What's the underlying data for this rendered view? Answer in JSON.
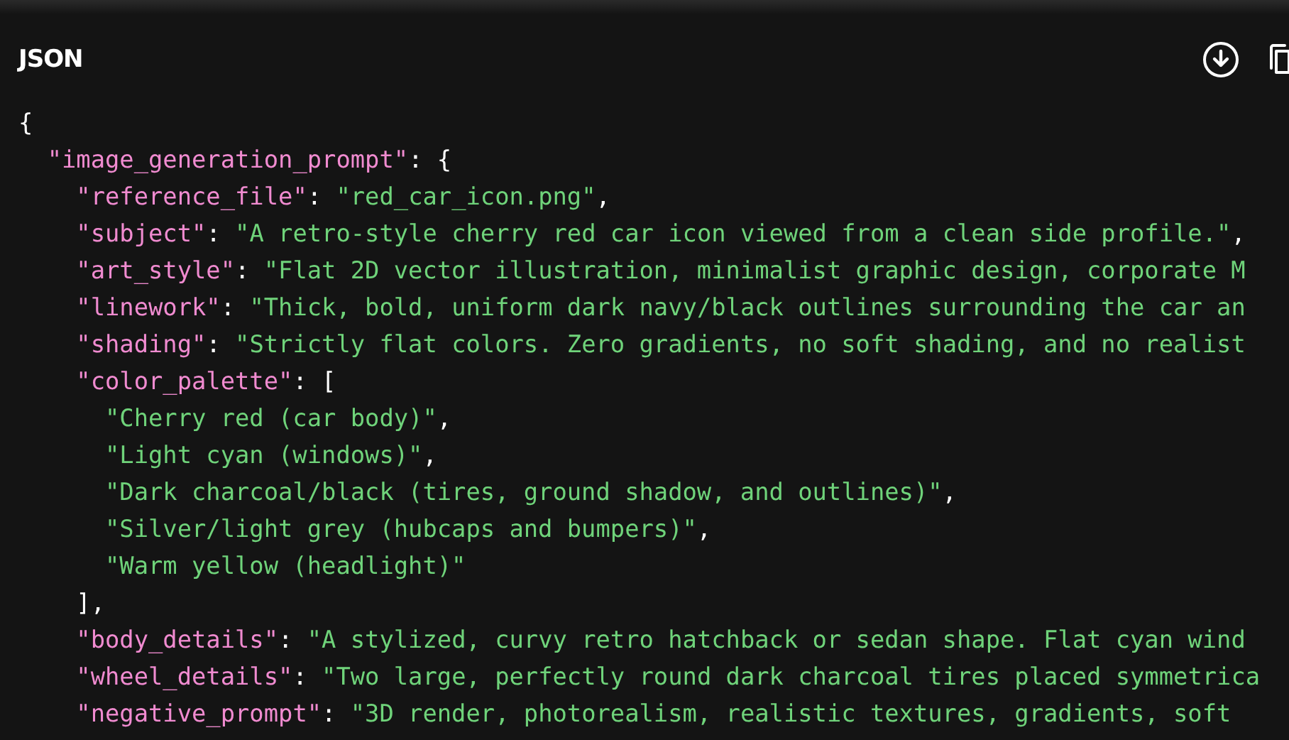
{
  "header": {
    "title": "JSON"
  },
  "code": {
    "tokens": [
      {
        "kind": "punct",
        "text": "{"
      }
    ],
    "children": [
      {
        "tokens": [
          {
            "kind": "key",
            "text": "\"image_generation_prompt\""
          },
          {
            "kind": "punct",
            "text": ": {"
          }
        ],
        "children": [
          {
            "tokens": [
              {
                "kind": "key",
                "text": "\"reference_file\""
              },
              {
                "kind": "punct",
                "text": ": "
              },
              {
                "kind": "string",
                "text": "\"red_car_icon.png\""
              },
              {
                "kind": "punct",
                "text": ","
              }
            ]
          },
          {
            "tokens": [
              {
                "kind": "key",
                "text": "\"subject\""
              },
              {
                "kind": "punct",
                "text": ": "
              },
              {
                "kind": "string",
                "text": "\"A retro-style cherry red car icon viewed from a clean side profile.\""
              },
              {
                "kind": "punct",
                "text": ","
              }
            ]
          },
          {
            "tokens": [
              {
                "kind": "key",
                "text": "\"art_style\""
              },
              {
                "kind": "punct",
                "text": ": "
              },
              {
                "kind": "string",
                "text": "\"Flat 2D vector illustration, minimalist graphic design, corporate M"
              }
            ]
          },
          {
            "tokens": [
              {
                "kind": "key",
                "text": "\"linework\""
              },
              {
                "kind": "punct",
                "text": ": "
              },
              {
                "kind": "string",
                "text": "\"Thick, bold, uniform dark navy/black outlines surrounding the car an"
              }
            ]
          },
          {
            "tokens": [
              {
                "kind": "key",
                "text": "\"shading\""
              },
              {
                "kind": "punct",
                "text": ": "
              },
              {
                "kind": "string",
                "text": "\"Strictly flat colors. Zero gradients, no soft shading, and no realist"
              }
            ]
          },
          {
            "tokens": [
              {
                "kind": "key",
                "text": "\"color_palette\""
              },
              {
                "kind": "punct",
                "text": ": ["
              }
            ],
            "children": [
              {
                "tokens": [
                  {
                    "kind": "string",
                    "text": "\"Cherry red (car body)\""
                  },
                  {
                    "kind": "punct",
                    "text": ","
                  }
                ]
              },
              {
                "tokens": [
                  {
                    "kind": "string",
                    "text": "\"Light cyan (windows)\""
                  },
                  {
                    "kind": "punct",
                    "text": ","
                  }
                ]
              },
              {
                "tokens": [
                  {
                    "kind": "string",
                    "text": "\"Dark charcoal/black (tires, ground shadow, and outlines)\""
                  },
                  {
                    "kind": "punct",
                    "text": ","
                  }
                ]
              },
              {
                "tokens": [
                  {
                    "kind": "string",
                    "text": "\"Silver/light grey (hubcaps and bumpers)\""
                  },
                  {
                    "kind": "punct",
                    "text": ","
                  }
                ]
              },
              {
                "tokens": [
                  {
                    "kind": "string",
                    "text": "\"Warm yellow (headlight)\""
                  }
                ]
              }
            ],
            "closing": [
              {
                "kind": "punct",
                "text": "],"
              }
            ]
          },
          {
            "tokens": [
              {
                "kind": "key",
                "text": "\"body_details\""
              },
              {
                "kind": "punct",
                "text": ": "
              },
              {
                "kind": "string",
                "text": "\"A stylized, curvy retro hatchback or sedan shape. Flat cyan wind"
              }
            ]
          },
          {
            "tokens": [
              {
                "kind": "key",
                "text": "\"wheel_details\""
              },
              {
                "kind": "punct",
                "text": ": "
              },
              {
                "kind": "string",
                "text": "\"Two large, perfectly round dark charcoal tires placed symmetrica"
              }
            ]
          },
          {
            "tokens": [
              {
                "kind": "key",
                "text": "\"negative_prompt\""
              },
              {
                "kind": "punct",
                "text": ": "
              },
              {
                "kind": "string",
                "text": "\"3D render, photorealism, realistic textures, gradients, soft"
              }
            ]
          }
        ]
      }
    ]
  }
}
